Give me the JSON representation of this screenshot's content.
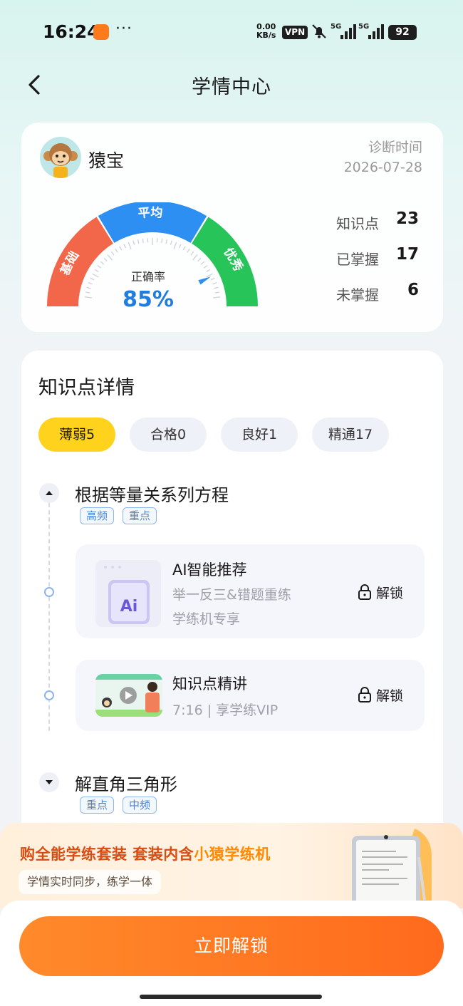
{
  "status_bar": {
    "time": "16:24",
    "dots": "···",
    "net_speed_value": "0.00",
    "net_speed_unit": "KB/s",
    "vpn": "VPN",
    "signal_1": "5G",
    "signal_2": "5G",
    "battery": "92"
  },
  "header": {
    "title": "学情中心"
  },
  "profile": {
    "name": "猿宝",
    "diagnosis_label": "诊断时间",
    "diagnosis_date": "2026-07-28"
  },
  "gauge": {
    "segments": [
      "基础",
      "平均",
      "优秀"
    ],
    "label": "正确率",
    "value": "85%",
    "fraction": 0.85,
    "colors": {
      "low": "#f2664a",
      "mid": "#2e8ff3",
      "high": "#27c45a",
      "value_text": "#1f7de0"
    }
  },
  "stats": [
    {
      "label": "知识点",
      "value": "23"
    },
    {
      "label": "已掌握",
      "value": "17"
    },
    {
      "label": "未掌握",
      "value": "6"
    }
  ],
  "details": {
    "title": "知识点详情",
    "tabs": [
      {
        "label": "薄弱5",
        "active": true
      },
      {
        "label": "合格0",
        "active": false
      },
      {
        "label": "良好1",
        "active": false
      },
      {
        "label": "精通17",
        "active": false
      }
    ],
    "points": [
      {
        "title": "根据等量关系列方程",
        "tags": [
          "高频",
          "重点"
        ],
        "expanded": true,
        "resources": [
          {
            "title": "AI智能推荐",
            "sub1": "举一反三&错题重练",
            "sub2": "学练机专享",
            "action": "解锁",
            "thumb_text": "Ai"
          },
          {
            "title": "知识点精讲",
            "sub1": "7:16 | 享学练VIP",
            "action": "解锁"
          }
        ]
      },
      {
        "title": "解直角三角形",
        "tags": [
          "重点",
          "中频"
        ],
        "expanded": false
      }
    ]
  },
  "promo": {
    "title_part1": "购全能学练套装 套装内含",
    "title_highlight": "小猿学练机",
    "subtitle": "学情实时同步，练学一体"
  },
  "cta": {
    "label": "立即解锁"
  }
}
